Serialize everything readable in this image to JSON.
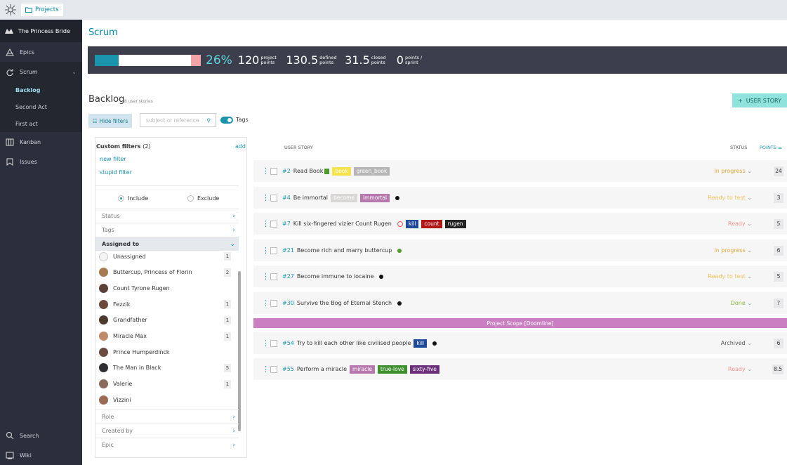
{
  "topbar": {
    "projects_label": "Projects"
  },
  "sidebar": {
    "project_name": "The Princess Bride",
    "items": [
      {
        "label": "Epics"
      },
      {
        "label": "Scrum"
      },
      {
        "label": "Kanban"
      },
      {
        "label": "Issues"
      }
    ],
    "scrum_sub": [
      "Backlog",
      "Second Act",
      "First act"
    ],
    "bottom": [
      {
        "label": "Search"
      },
      {
        "label": "Wiki"
      }
    ]
  },
  "page": {
    "title": "Scrum"
  },
  "stats": {
    "progress_percent": 26,
    "percent_text": "26%",
    "project_points": {
      "value": "120",
      "label1": "project",
      "label2": "points"
    },
    "defined_points": {
      "value": "130.5",
      "label1": "defined",
      "label2": "points"
    },
    "closed_points": {
      "value": "31.5",
      "label1": "closed",
      "label2": "points"
    },
    "points_sprint": {
      "value": "0",
      "label1": "points /",
      "label2": "sprint"
    }
  },
  "backlog": {
    "title": "Backlog",
    "count": "8 user stories",
    "add_button": "USER STORY",
    "hide_filters": "Hide filters",
    "search_placeholder": "subject or reference",
    "tags_label": "Tags"
  },
  "filters": {
    "custom_title": "Custom filters",
    "custom_count": "(2)",
    "add": "add",
    "custom": [
      "new filter",
      "stupid filter"
    ],
    "include": "Include",
    "exclude": "Exclude",
    "status": "Status",
    "tags": "Tags",
    "assigned_to": "Assigned to",
    "people": [
      {
        "name": "Unassigned",
        "count": "1",
        "color": "#f4f4f4"
      },
      {
        "name": "Buttercup, Princess of Florin",
        "count": "2",
        "color": "#a77a4f"
      },
      {
        "name": "Count Tyrone Rugen",
        "count": "",
        "color": "#5a4238"
      },
      {
        "name": "Fezzik",
        "count": "1",
        "color": "#6b4a3c"
      },
      {
        "name": "Grandfather",
        "count": "1",
        "color": "#4e3b30"
      },
      {
        "name": "Miracle Max",
        "count": "1",
        "color": "#c18a6a"
      },
      {
        "name": "Prince Humperdinck",
        "count": "",
        "color": "#6a4b40"
      },
      {
        "name": "The Man in Black",
        "count": "5",
        "color": "#2e2e34"
      },
      {
        "name": "Valerie",
        "count": "1",
        "color": "#8a6a5a"
      },
      {
        "name": "Vizzini",
        "count": "",
        "color": "#9a6b55"
      }
    ],
    "role": "Role",
    "created_by": "Created by",
    "epic": "Epic"
  },
  "table": {
    "col_story": "USER STORY",
    "col_status": "STATUS",
    "col_points": "POINTS"
  },
  "stories": [
    {
      "ref": "#2",
      "subject": "Read Book",
      "tags": [
        {
          "t": "book",
          "c": "#f6e24a"
        },
        {
          "t": "green_book",
          "c": "#b5b5b5"
        }
      ],
      "dot": "",
      "status": "In progress",
      "status_color": "#e0a93a",
      "points": "24"
    },
    {
      "ref": "#4",
      "subject": "Be immortal",
      "tags": [
        {
          "t": "become",
          "c": "#d9d6d6"
        },
        {
          "t": "immortal",
          "c": "#b778ae"
        }
      ],
      "dot": "#111",
      "status": "Ready to test",
      "status_color": "#f0c35a",
      "points": "3"
    },
    {
      "ref": "#7",
      "subject": "Kill six-fingered vizier Count Rugen",
      "tags": [
        {
          "t": "kill",
          "c": "#1f4a9a"
        },
        {
          "t": "count",
          "c": "#b01818"
        },
        {
          "t": "rugen",
          "c": "#222"
        }
      ],
      "dot": "",
      "status": "Ready",
      "status_color": "#f2958f",
      "points": "5"
    },
    {
      "ref": "#21",
      "subject": "Become rich and marry buttercup",
      "tags": [],
      "dot": "#4e9a2a",
      "status": "In progress",
      "status_color": "#e0a93a",
      "points": "6"
    },
    {
      "ref": "#27",
      "subject": "Become immune to iocaine",
      "tags": [],
      "dot": "#111",
      "status": "Ready to test",
      "status_color": "#f0c35a",
      "points": "5"
    },
    {
      "ref": "#30",
      "subject": "Survive the Bog of Eternal Stench",
      "tags": [],
      "dot": "#111",
      "status": "Done",
      "status_color": "#8ab532",
      "points": "?"
    }
  ],
  "sprint_header": "Project Scope [Doomline]",
  "stories2": [
    {
      "ref": "#54",
      "subject": "Try to kill each other like civilised people",
      "tags": [
        {
          "t": "kill",
          "c": "#1f4a9a"
        }
      ],
      "dot": "#111",
      "status": "Archived",
      "status_color": "#555",
      "points": "6"
    },
    {
      "ref": "#55",
      "subject": "Perform a miracle",
      "tags": [
        {
          "t": "miracle",
          "c": "#b778ae"
        },
        {
          "t": "true-love",
          "c": "#3e8f2e"
        },
        {
          "t": "sixty-five",
          "c": "#6b2f7a"
        }
      ],
      "dot": "",
      "status": "Ready",
      "status_color": "#f2958f",
      "points": "8.5"
    }
  ]
}
